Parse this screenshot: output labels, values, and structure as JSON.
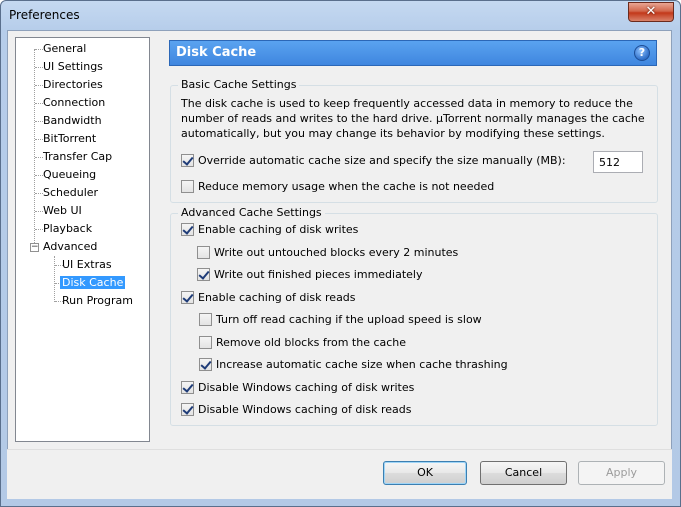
{
  "window": {
    "title": "Preferences"
  },
  "tree": {
    "items": [
      {
        "label": "General"
      },
      {
        "label": "UI Settings"
      },
      {
        "label": "Directories"
      },
      {
        "label": "Connection"
      },
      {
        "label": "Bandwidth"
      },
      {
        "label": "BitTorrent"
      },
      {
        "label": "Transfer Cap"
      },
      {
        "label": "Queueing"
      },
      {
        "label": "Scheduler"
      },
      {
        "label": "Web UI"
      },
      {
        "label": "Playback"
      },
      {
        "label": "Advanced",
        "expanded": true
      }
    ],
    "children": [
      {
        "label": "UI Extras"
      },
      {
        "label": "Disk Cache",
        "selected": true
      },
      {
        "label": "Run Program"
      }
    ]
  },
  "header": {
    "title": "Disk Cache",
    "help_icon": "help-icon"
  },
  "basic": {
    "group_title": "Basic Cache Settings",
    "description": "The disk cache is used to keep frequently accessed data in memory to reduce the number of reads and writes to the hard drive. µTorrent normally manages the cache automatically, but you may change its behavior by modifying these settings.",
    "override_label": "Override automatic cache size and specify the size manually (MB):",
    "override_checked": true,
    "cache_size_value": "512",
    "reduce_memory_label": "Reduce memory usage when the cache is not needed",
    "reduce_memory_checked": false
  },
  "advanced": {
    "group_title": "Advanced Cache Settings",
    "enable_writes_label": "Enable caching of disk writes",
    "write_untouched_label": "Write out untouched blocks every 2 minutes",
    "write_finished_label": "Write out finished pieces immediately",
    "enable_reads_label": "Enable caching of disk reads",
    "turn_off_read_label": "Turn off read caching if the upload speed is slow",
    "remove_old_label": "Remove old blocks from the cache",
    "increase_auto_label": "Increase automatic cache size when cache thrashing",
    "disable_win_writes_label": "Disable Windows caching of disk writes",
    "disable_win_reads_label": "Disable Windows caching of disk reads"
  },
  "buttons": {
    "ok": "OK",
    "cancel": "Cancel",
    "apply": "Apply"
  }
}
